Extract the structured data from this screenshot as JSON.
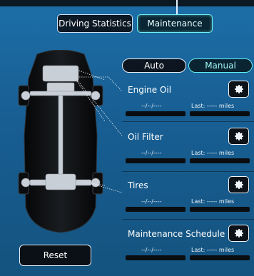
{
  "tabs": {
    "driving_statistics": "Driving Statistics",
    "maintenance": "Maintenance"
  },
  "mode": {
    "auto": "Auto",
    "manual": "Manual",
    "selected": "Manual"
  },
  "items": [
    {
      "name": "Engine Oil",
      "date": "--/--/----",
      "last": "Last: ----- miles"
    },
    {
      "name": "Oil Filter",
      "date": "--/--/----",
      "last": "Last: ----- miles"
    },
    {
      "name": "Tires",
      "date": "--/--/----",
      "last": "Last: ----- miles"
    },
    {
      "name": "Maintenance Schedule",
      "date": "--/--/----",
      "last": "Last: ----- miles"
    }
  ],
  "reset_label": "Reset",
  "colors": {
    "accent": "#62f0ef",
    "background": "#1d6ea8"
  },
  "icons": {
    "settings": "gear-icon",
    "vehicle": "car-chassis-illustration"
  }
}
